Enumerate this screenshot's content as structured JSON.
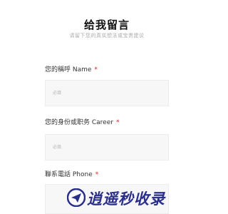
{
  "header": {
    "title": "给我留言",
    "subtitle": "请留下您的真实想法或宝贵建议"
  },
  "form": {
    "required_mark": "*",
    "fields": [
      {
        "label": "您的稱呼 Name",
        "placeholder": "必填",
        "value": ""
      },
      {
        "label": "您的身份或职务 Career",
        "placeholder": "必填",
        "value": ""
      },
      {
        "label": "聯系電話 Phone",
        "placeholder": "",
        "value": ""
      }
    ]
  },
  "watermark": {
    "text": "逍遥秒收录",
    "icon": "paper-plane-icon",
    "color": "#2a2f8a"
  }
}
